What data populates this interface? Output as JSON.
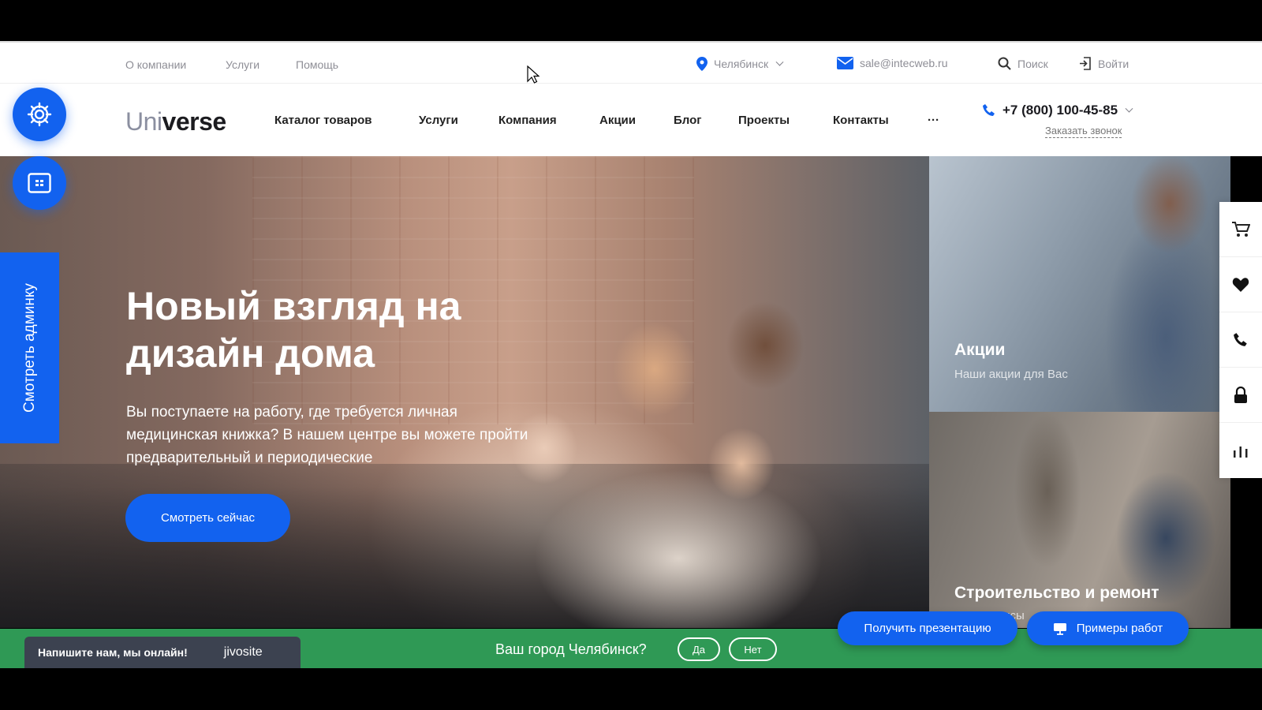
{
  "topbar": {
    "links": [
      "О компании",
      "Услуги",
      "Помощь"
    ],
    "city": "Челябинск",
    "email": "sale@intecweb.ru",
    "search": "Поиск",
    "login": "Войти"
  },
  "header": {
    "logo_light": "Uni",
    "logo_bold": "verse",
    "nav": [
      "Каталог товаров",
      "Услуги",
      "Компания",
      "Акции",
      "Блог",
      "Проекты",
      "Контакты",
      "···"
    ],
    "phone": "+7 (800) 100-45-85",
    "callback": "Заказать звонок"
  },
  "admin_tab": "Смотреть админку",
  "hero": {
    "title": "Новый взгляд на дизайн дома",
    "text": "Вы поступаете на работу, где требуется личная медицинская книжка? В нашем центре вы можете пройти предварительный и периодические",
    "button": "Смотреть сейчас"
  },
  "tiles": [
    {
      "title": "Акции",
      "subtitle": "Наши акции для Вас"
    },
    {
      "title": "Строительство и ремонт",
      "subtitle": "Все сервисы"
    }
  ],
  "bottombar": {
    "jivo_text": "Напишите нам, мы онлайн!",
    "jivo_brand": "jivosite",
    "city_question": "Ваш город Челябинск?",
    "yes": "Да",
    "no": "Нет",
    "presentation": "Получить презентацию",
    "portfolio": "Примеры работ"
  },
  "colors": {
    "accent": "#1262ef",
    "green_bar": "#2f9955",
    "jivo": "#3c4250"
  },
  "icons": [
    "settings-gear-icon",
    "layout-icon",
    "location-pin-icon",
    "mail-icon",
    "search-icon",
    "login-icon",
    "phone-icon",
    "cart-icon",
    "heart-icon",
    "lock-icon",
    "chart-icon",
    "presentation-icon"
  ]
}
